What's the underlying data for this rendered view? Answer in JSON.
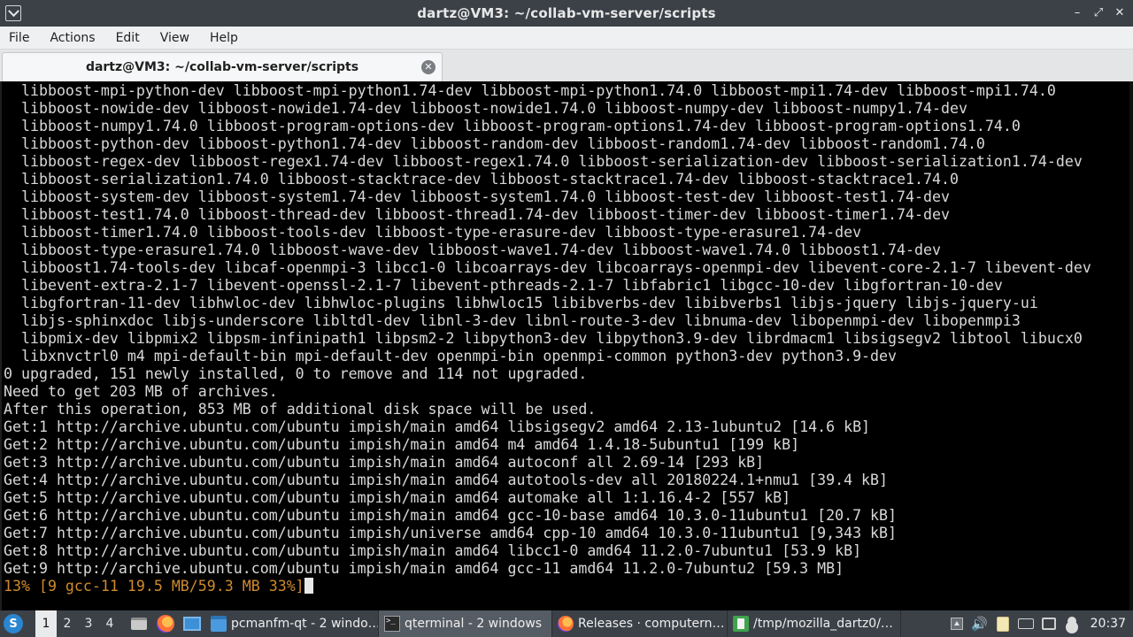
{
  "window": {
    "title": "dartz@VM3: ~/collab-vm-server/scripts"
  },
  "menubar": {
    "items": [
      "File",
      "Actions",
      "Edit",
      "View",
      "Help"
    ]
  },
  "tabs": [
    {
      "label": "dartz@VM3: ~/collab-vm-server/scripts"
    }
  ],
  "terminal": {
    "lines": [
      "  libboost-mpi-python-dev libboost-mpi-python1.74-dev libboost-mpi-python1.74.0 libboost-mpi1.74-dev libboost-mpi1.74.0",
      "  libboost-nowide-dev libboost-nowide1.74-dev libboost-nowide1.74.0 libboost-numpy-dev libboost-numpy1.74-dev",
      "  libboost-numpy1.74.0 libboost-program-options-dev libboost-program-options1.74-dev libboost-program-options1.74.0",
      "  libboost-python-dev libboost-python1.74-dev libboost-random-dev libboost-random1.74-dev libboost-random1.74.0",
      "  libboost-regex-dev libboost-regex1.74-dev libboost-regex1.74.0 libboost-serialization-dev libboost-serialization1.74-dev",
      "  libboost-serialization1.74.0 libboost-stacktrace-dev libboost-stacktrace1.74-dev libboost-stacktrace1.74.0",
      "  libboost-system-dev libboost-system1.74-dev libboost-system1.74.0 libboost-test-dev libboost-test1.74-dev",
      "  libboost-test1.74.0 libboost-thread-dev libboost-thread1.74-dev libboost-timer-dev libboost-timer1.74-dev",
      "  libboost-timer1.74.0 libboost-tools-dev libboost-type-erasure-dev libboost-type-erasure1.74-dev",
      "  libboost-type-erasure1.74.0 libboost-wave-dev libboost-wave1.74-dev libboost-wave1.74.0 libboost1.74-dev",
      "  libboost1.74-tools-dev libcaf-openmpi-3 libcc1-0 libcoarrays-dev libcoarrays-openmpi-dev libevent-core-2.1-7 libevent-dev",
      "  libevent-extra-2.1-7 libevent-openssl-2.1-7 libevent-pthreads-2.1-7 libfabric1 libgcc-10-dev libgfortran-10-dev",
      "  libgfortran-11-dev libhwloc-dev libhwloc-plugins libhwloc15 libibverbs-dev libibverbs1 libjs-jquery libjs-jquery-ui",
      "  libjs-sphinxdoc libjs-underscore libltdl-dev libnl-3-dev libnl-route-3-dev libnuma-dev libopenmpi-dev libopenmpi3",
      "  libpmix-dev libpmix2 libpsm-infinipath1 libpsm2-2 libpython3-dev libpython3.9-dev librdmacm1 libsigsegv2 libtool libucx0",
      "  libxnvctrl0 m4 mpi-default-bin mpi-default-dev openmpi-bin openmpi-common python3-dev python3.9-dev",
      "0 upgraded, 151 newly installed, 0 to remove and 114 not upgraded.",
      "Need to get 203 MB of archives.",
      "After this operation, 853 MB of additional disk space will be used.",
      "Get:1 http://archive.ubuntu.com/ubuntu impish/main amd64 libsigsegv2 amd64 2.13-1ubuntu2 [14.6 kB]",
      "Get:2 http://archive.ubuntu.com/ubuntu impish/main amd64 m4 amd64 1.4.18-5ubuntu1 [199 kB]",
      "Get:3 http://archive.ubuntu.com/ubuntu impish/main amd64 autoconf all 2.69-14 [293 kB]",
      "Get:4 http://archive.ubuntu.com/ubuntu impish/main amd64 autotools-dev all 20180224.1+nmu1 [39.4 kB]",
      "Get:5 http://archive.ubuntu.com/ubuntu impish/main amd64 automake all 1:1.16.4-2 [557 kB]",
      "Get:6 http://archive.ubuntu.com/ubuntu impish/main amd64 gcc-10-base amd64 10.3.0-11ubuntu1 [20.7 kB]",
      "Get:7 http://archive.ubuntu.com/ubuntu impish/universe amd64 cpp-10 amd64 10.3.0-11ubuntu1 [9,343 kB]",
      "Get:8 http://archive.ubuntu.com/ubuntu impish/main amd64 libcc1-0 amd64 11.2.0-7ubuntu1 [53.9 kB]",
      "Get:9 http://archive.ubuntu.com/ubuntu impish/main amd64 gcc-11 amd64 11.2.0-7ubuntu2 [59.3 MB]"
    ],
    "progress_line": "13% [9 gcc-11 19.5 MB/59.3 MB 33%]",
    "progress_color": "#d08b2c"
  },
  "taskbar": {
    "start_icon": "start-menu-icon",
    "desktops": [
      "1",
      "2",
      "3",
      "4"
    ],
    "active_desktop": "1",
    "quicklaunch": [
      "file-manager-icon",
      "firefox-icon",
      "show-desktop-icon"
    ],
    "tasks": [
      {
        "label": "pcmanfm-qt - 2 windo…",
        "icon": "folder-icon"
      },
      {
        "label": "qterminal - 2 windows",
        "icon": "terminal-icon"
      },
      {
        "label": "Releases · computern…",
        "icon": "firefox-icon"
      },
      {
        "label": "/tmp/mozilla_dartz0/…",
        "icon": "document-icon"
      }
    ],
    "active_task": "qterminal - 2 windows",
    "clock": "20:37"
  }
}
